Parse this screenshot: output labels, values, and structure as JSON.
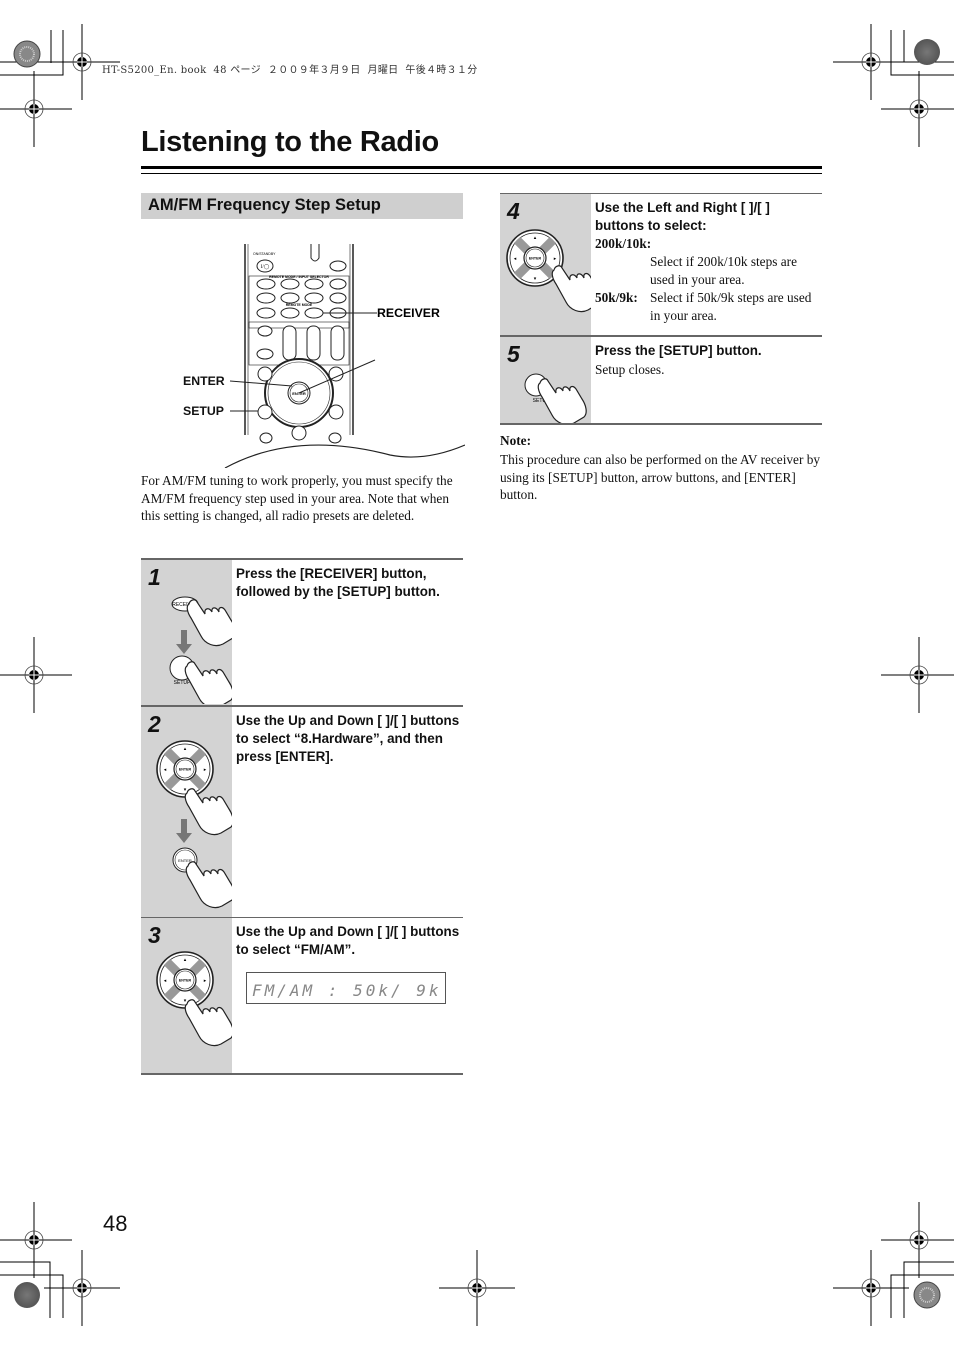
{
  "print_header": "HT-S5200_En. book  48 ページ  ２００９年３月９日  月曜日  午後４時３１分",
  "page": {
    "title": "Listening to the Radio",
    "number": "48"
  },
  "section": {
    "heading": "AM/FM Frequency Step Setup",
    "figure_callouts": {
      "receiver": "RECEIVER",
      "enter": "ENTER",
      "setup": "SETUP"
    },
    "intro": "For AM/FM tuning to work properly, you must specify the AM/FM frequency step used in your area. Note that when this setting is changed, all radio presets are deleted."
  },
  "steps": [
    {
      "number": "1",
      "heading": "Press the [RECEIVER] button, followed by the [SETUP] button.",
      "icon_labels": [
        "RECEIVER",
        "SETUP"
      ]
    },
    {
      "number": "2",
      "heading": "Use the Up and Down [   ]/[   ] buttons to select “8.Hardware”, and then press [ENTER].",
      "icon_labels": [
        "ENTER",
        "ENTER"
      ]
    },
    {
      "number": "3",
      "heading": "Use the Up and Down [   ]/[   ] buttons to select “FM/AM”.",
      "display": "FM/AM : 50k/ 9k",
      "icon_labels": [
        "ENTER"
      ]
    },
    {
      "number": "4",
      "heading": "Use the Left and Right [   ]/[   ] buttons to select:",
      "options": [
        {
          "term": "200k/10k:",
          "desc": "Select if 200k/10k steps are used in your area."
        },
        {
          "term": "50k/9k:",
          "desc": "Select if 50k/9k steps are used in your area."
        }
      ],
      "icon_labels": [
        "ENTER"
      ]
    },
    {
      "number": "5",
      "heading": "Press the [SETUP] button.",
      "body": "Setup closes.",
      "icon_labels": [
        "SETUP"
      ]
    }
  ],
  "note": {
    "title": "Note:",
    "body": "This procedure can also be performed on the AV receiver by using its [SETUP] button, arrow buttons, and [ENTER] button."
  }
}
